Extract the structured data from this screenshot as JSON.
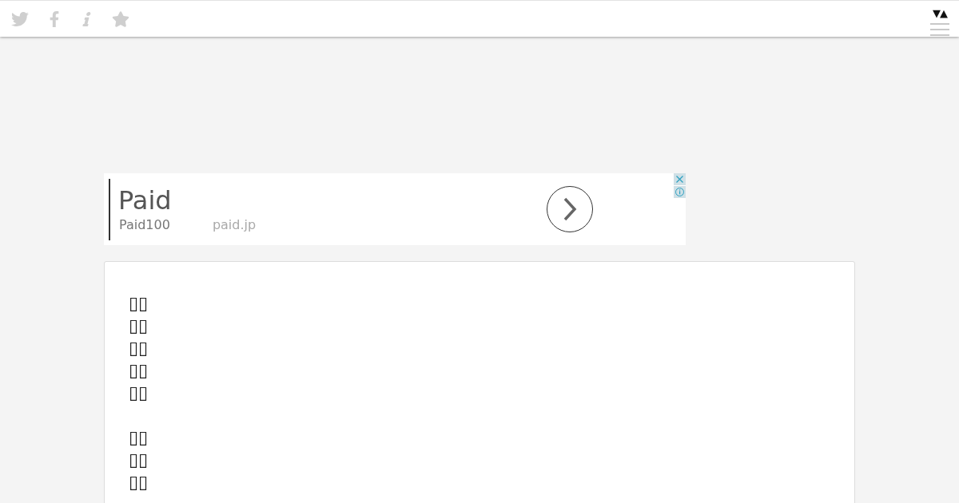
{
  "toolbar": {
    "toggle": "▼▲"
  },
  "ad": {
    "title": "Paid",
    "advertiser": "Paid100",
    "url": "paid.jp"
  },
  "article": {
    "paragraphs": [
      {
        "lines": [
          "▯▯",
          "▯▯",
          "▯▯",
          "▯▯",
          "▯▯"
        ]
      },
      {
        "lines": [
          "▯▯",
          "▯▯",
          "▯▯"
        ]
      }
    ]
  }
}
